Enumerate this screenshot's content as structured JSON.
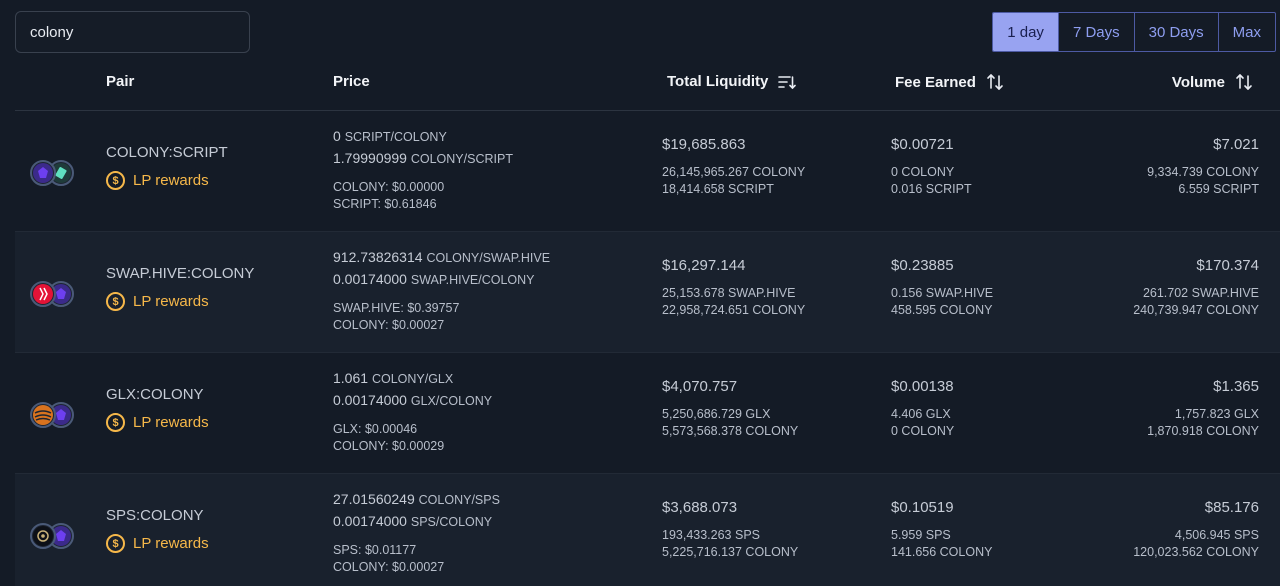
{
  "search": {
    "value": "colony"
  },
  "periods": [
    "1 day",
    "7 Days",
    "30 Days",
    "Max"
  ],
  "headers": {
    "pair": "Pair",
    "price": "Price",
    "liquidity": "Total Liquidity",
    "fee": "Fee Earned",
    "volume": "Volume"
  },
  "lp_label": "LP rewards",
  "rows": [
    {
      "pair": "COLONY:SCRIPT",
      "price1_num": "0",
      "price1_unit": "SCRIPT/COLONY",
      "price2_num": "1.79990999",
      "price2_unit": "COLONY/SCRIPT",
      "usd1": "COLONY: $0.00000",
      "usd2": "SCRIPT: $0.61846",
      "liq": "$19,685.863",
      "liq1": "26,145,965.267 COLONY",
      "liq2": "18,414.658 SCRIPT",
      "fee": "$0.00721",
      "fee1": "0 COLONY",
      "fee2": "0.016 SCRIPT",
      "vol": "$7.021",
      "vol1": "9,334.739 COLONY",
      "vol2": "6.559 SCRIPT"
    },
    {
      "pair": "SWAP.HIVE:COLONY",
      "price1_num": "912.73826314",
      "price1_unit": "COLONY/SWAP.HIVE",
      "price2_num": "0.00174000",
      "price2_unit": "SWAP.HIVE/COLONY",
      "usd1": "SWAP.HIVE: $0.39757",
      "usd2": "COLONY: $0.00027",
      "liq": "$16,297.144",
      "liq1": "25,153.678 SWAP.HIVE",
      "liq2": "22,958,724.651 COLONY",
      "fee": "$0.23885",
      "fee1": "0.156 SWAP.HIVE",
      "fee2": "458.595 COLONY",
      "vol": "$170.374",
      "vol1": "261.702 SWAP.HIVE",
      "vol2": "240,739.947 COLONY"
    },
    {
      "pair": "GLX:COLONY",
      "price1_num": "1.061",
      "price1_unit": "COLONY/GLX",
      "price2_num": "0.00174000",
      "price2_unit": "GLX/COLONY",
      "usd1": "GLX: $0.00046",
      "usd2": "COLONY: $0.00029",
      "liq": "$4,070.757",
      "liq1": "5,250,686.729 GLX",
      "liq2": "5,573,568.378 COLONY",
      "fee": "$0.00138",
      "fee1": "4.406 GLX",
      "fee2": "0 COLONY",
      "vol": "$1.365",
      "vol1": "1,757.823 GLX",
      "vol2": "1,870.918 COLONY"
    },
    {
      "pair": "SPS:COLONY",
      "price1_num": "27.01560249",
      "price1_unit": "COLONY/SPS",
      "price2_num": "0.00174000",
      "price2_unit": "SPS/COLONY",
      "usd1": "SPS: $0.01177",
      "usd2": "COLONY: $0.00027",
      "liq": "$3,688.073",
      "liq1": "193,433.263 SPS",
      "liq2": "5,225,716.137 COLONY",
      "fee": "$0.10519",
      "fee1": "5.959 SPS",
      "fee2": "141.656 COLONY",
      "vol": "$85.176",
      "vol1": "4,506.945 SPS",
      "vol2": "120,023.562 COLONY"
    }
  ],
  "colors": {
    "accent": "#98a3f1",
    "lp": "#f6b84a",
    "bg": "#141b26"
  }
}
